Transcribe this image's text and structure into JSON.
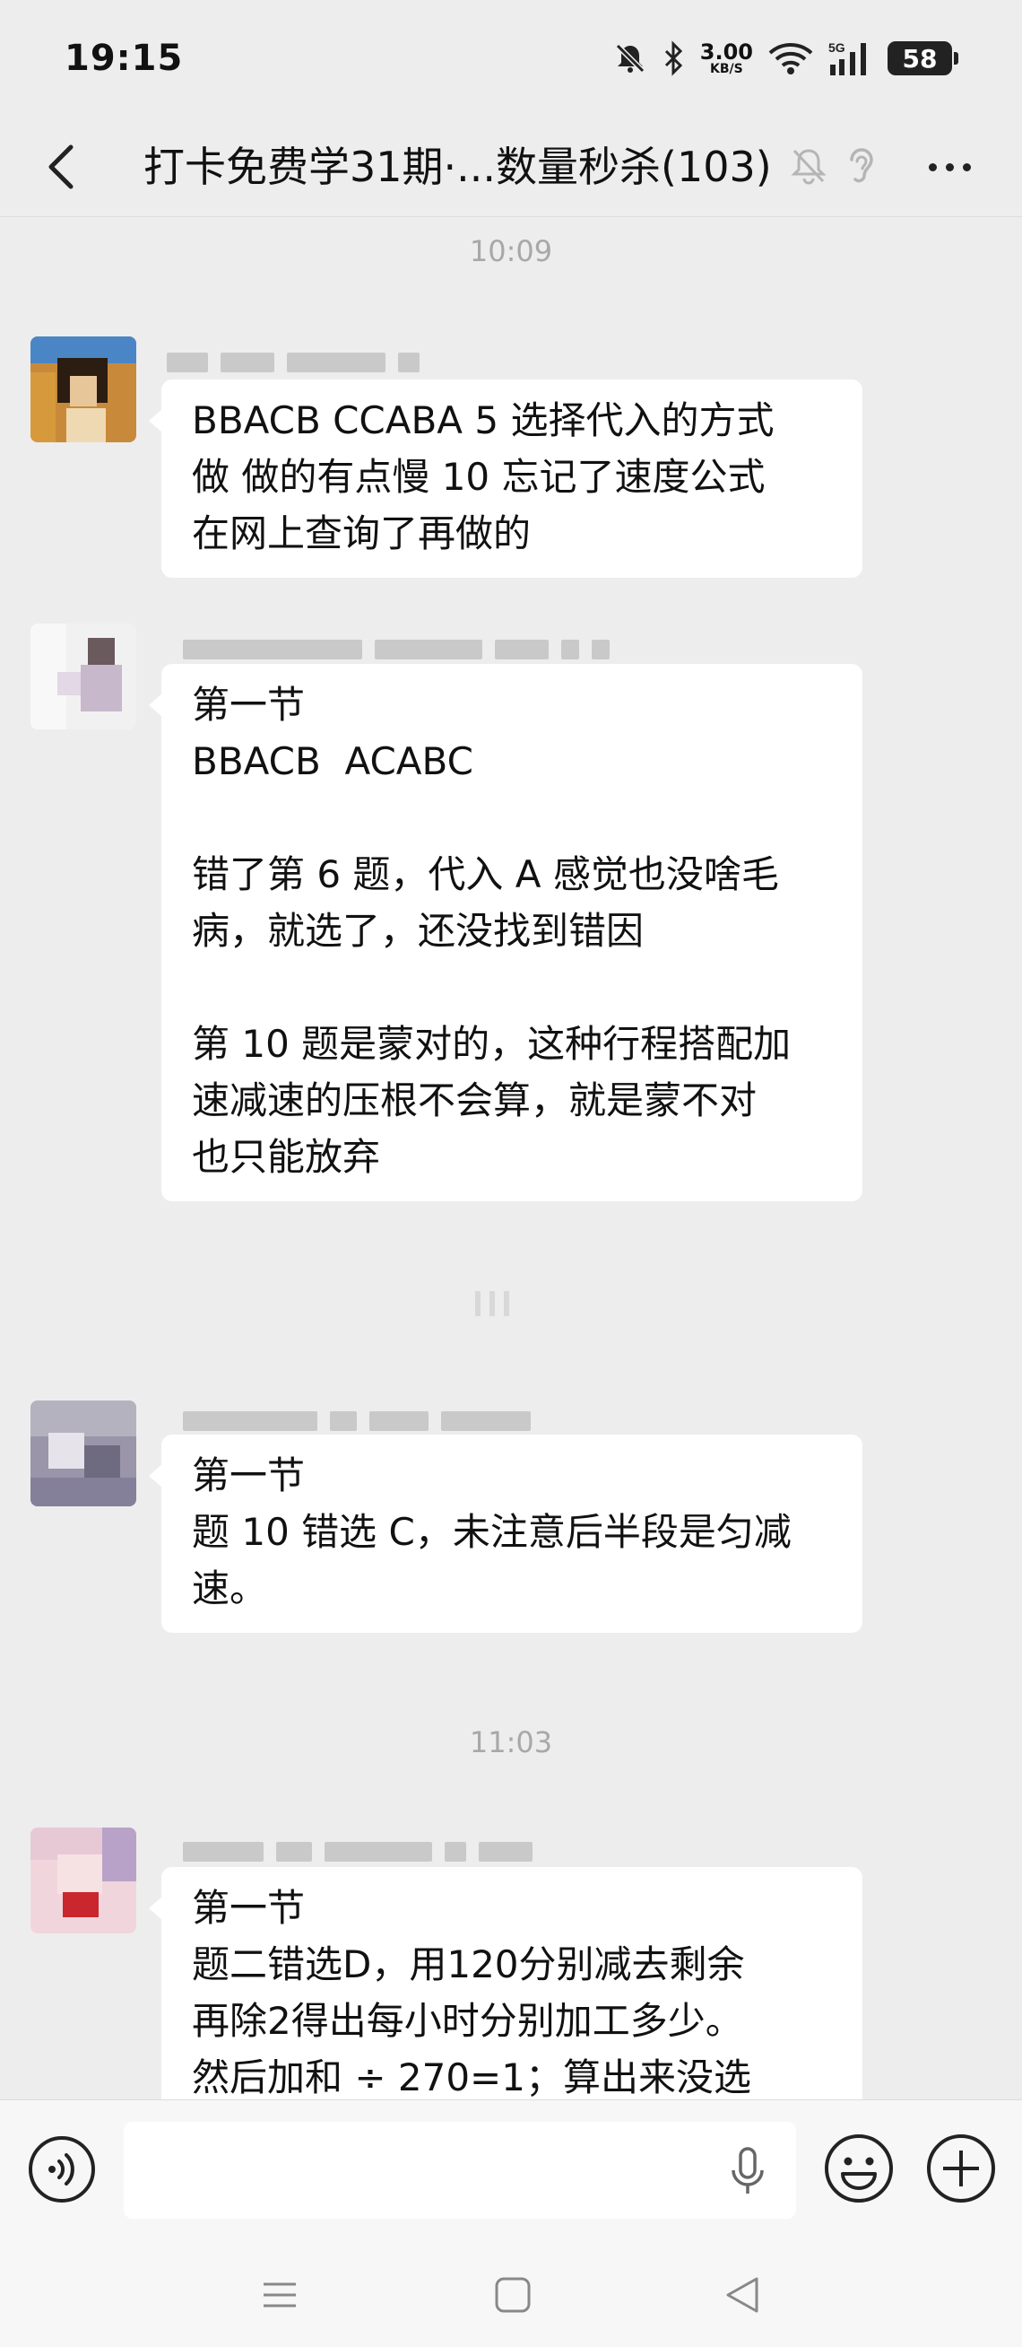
{
  "status_bar": {
    "time": "19:15",
    "net_speed_value": "3.00",
    "net_speed_unit": "KB/S",
    "network_type": "5G",
    "battery": "58"
  },
  "header": {
    "title": "打卡免费学31期·...数量秒杀(103)"
  },
  "messages": {
    "ts1": "10:09",
    "m1": {
      "lines": [
        "BBACB CCABA 5 选择代入的方式",
        "做 做的有点慢 10 忘记了速度公式",
        "在网上查询了再做的"
      ]
    },
    "m2": {
      "lines": [
        "第一节",
        "BBACB  ACABC",
        "",
        "错了第 6 题，代入 A 感觉也没啥毛",
        "病，就选了，还没找到错因",
        "",
        "第 10 题是蒙对的，这种行程搭配加",
        "速减速的压根不会算，就是蒙不对",
        "也只能放弃"
      ]
    },
    "m3": {
      "lines": [
        "第一节",
        "题 10 错选 C，未注意后半段是匀减",
        "速。"
      ]
    },
    "ts2": "11:03",
    "m4": {
      "lines": [
        "第一节",
        "题二错选D，用120分别减去剩余",
        "再除2得出每小时分别加工多少。",
        "然后加和 ÷ 270=1；算出来没选"
      ]
    }
  },
  "input": {
    "placeholder": ""
  },
  "icons": {
    "back": "back-arrow-icon",
    "mute": "bell-off-icon",
    "ear": "ear-icon",
    "more": "more-icon",
    "voice": "voice-icon",
    "mic": "mic-icon",
    "emoji": "emoji-icon",
    "plus": "plus-icon"
  },
  "colors": {
    "background": "#ededed",
    "bubble": "#ffffff",
    "timestamp": "#a8a8a8"
  }
}
